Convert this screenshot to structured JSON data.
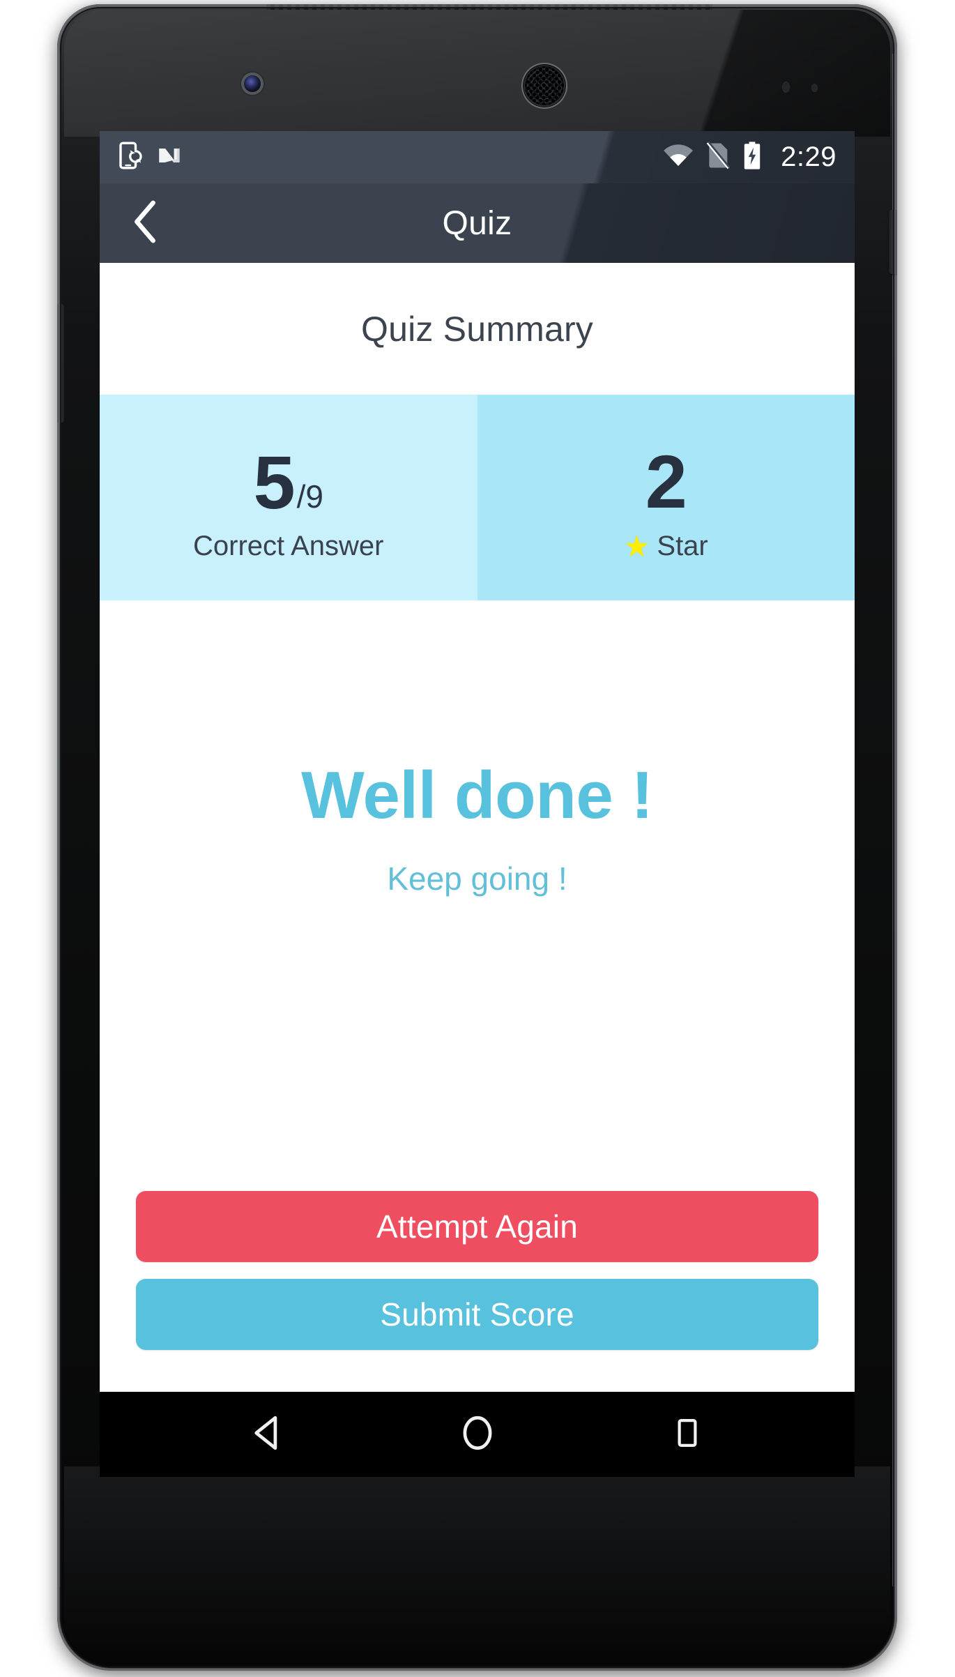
{
  "device": {
    "frame": "nexus-5-phone-mockup",
    "front_camera": "front-camera",
    "earpiece": "earpiece-speaker",
    "power_button": "power-button",
    "volume_button": "volume-button"
  },
  "status_bar": {
    "left_icons": [
      {
        "name": "phone-sync-icon",
        "label": "phone sync"
      },
      {
        "name": "android-nougat-icon",
        "label": "N"
      }
    ],
    "right_icons": [
      {
        "name": "wifi-icon",
        "label": "wifi"
      },
      {
        "name": "no-sim-icon",
        "label": "no sim"
      },
      {
        "name": "battery-charging-icon",
        "label": "battery charging"
      }
    ],
    "time": "2:29",
    "background_color": "#3b4452"
  },
  "app_bar": {
    "back_icon": "back-chevron-icon",
    "title": "Quiz",
    "background_color": "#333b47",
    "text_color": "#ffffff"
  },
  "summary": {
    "heading": "Quiz Summary"
  },
  "stats": [
    {
      "key": "correct-answer",
      "value": "5",
      "suffix": "/9",
      "label": "Correct Answer",
      "icon": null,
      "background_color": "#c9f0fd"
    },
    {
      "key": "star",
      "value": "2",
      "suffix": "",
      "label": "Star",
      "icon": "star-icon",
      "icon_glyph": "★",
      "icon_color": "#ffee00",
      "background_color": "#a9e6f7"
    }
  ],
  "message": {
    "headline": "Well done !",
    "subtext": "Keep going !",
    "headline_color": "#58c1dd",
    "subtext_color": "#62bfd8"
  },
  "actions": {
    "attempt_again": {
      "label": "Attempt Again",
      "color": "#ef4e60"
    },
    "submit_score": {
      "label": "Submit Score",
      "color": "#58c1dd"
    }
  },
  "nav_bar": {
    "back": "back-triangle-icon",
    "home": "home-circle-icon",
    "recents": "recents-square-icon",
    "background_color": "#000000"
  }
}
